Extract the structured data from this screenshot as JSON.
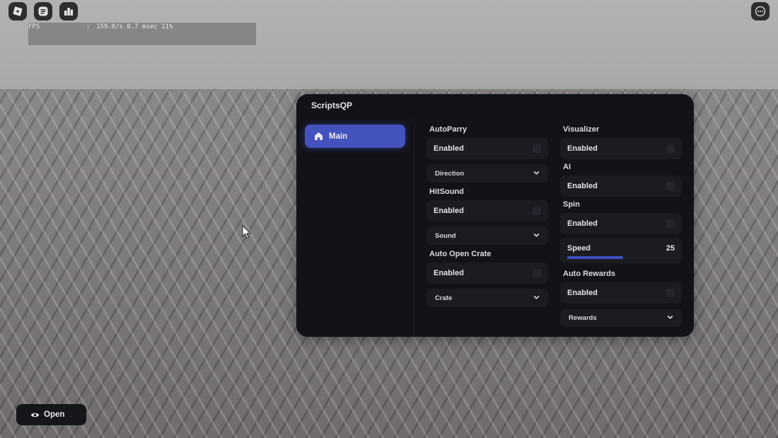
{
  "top_bar": {
    "left_icons": [
      "roblox-logo-icon",
      "chat-icon",
      "leaderboard-icon"
    ],
    "right_icons": [
      "more-options-icon"
    ]
  },
  "stats": {
    "label": "FPS",
    "separator": ":",
    "values": "159.0/s 0.7 msec 11%"
  },
  "panel": {
    "title": "ScriptsQP",
    "accent_color": "#4352bd",
    "tabs": [
      {
        "label": "Main",
        "icon": "home-icon",
        "selected": true
      }
    ],
    "left_column": {
      "autoparry": {
        "title": "AutoParry",
        "toggle_label": "Enabled",
        "dropdown_label": "Direction"
      },
      "hitsound": {
        "title": "HitSound",
        "toggle_label": "Enabled",
        "dropdown_label": "Sound"
      },
      "auto_open_crate": {
        "title": "Auto Open Crate",
        "toggle_label": "Enabled",
        "dropdown_label": "Crate"
      }
    },
    "right_column": {
      "visualizer": {
        "title": "Visualizer",
        "toggle_label": "Enabled"
      },
      "ai": {
        "title": "AI",
        "toggle_label": "Enabled"
      },
      "spin": {
        "title": "Spin",
        "toggle_label": "Enabled",
        "slider_label": "Speed",
        "slider_value": "25",
        "slider_fraction": 0.52
      },
      "auto_rewards": {
        "title": "Auto Rewards",
        "toggle_label": "Enabled",
        "dropdown_label": "Rewards"
      }
    }
  },
  "open_button": {
    "label": "Open",
    "icon": "eye-icon"
  }
}
